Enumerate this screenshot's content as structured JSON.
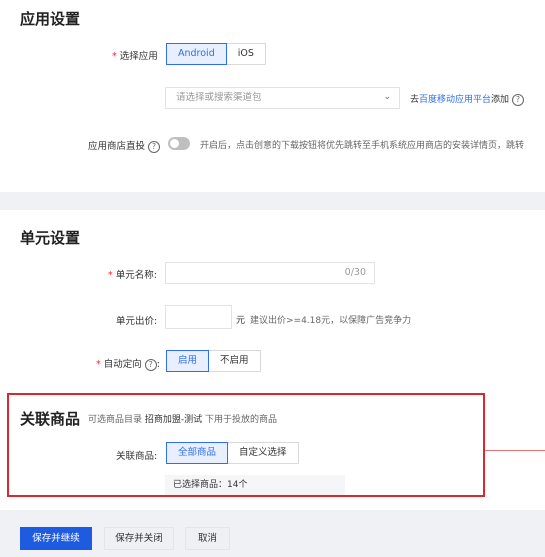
{
  "app_settings": {
    "title": "应用设置",
    "select_app_label": "选择应用",
    "required_mark": "*",
    "app_options": [
      "Android",
      "iOS"
    ],
    "selected_app": "Android",
    "channel_placeholder": "请选择或搜索渠道包",
    "add_prefix": "去",
    "add_link": "百度移动应用平台",
    "add_suffix": "添加",
    "store_direct_label": "应用商店直投",
    "store_direct_hint": "开启后，点击创意的下载按钮将优先跳转至手机系统应用商店的安装详情页，跳转",
    "store_direct_enabled": false
  },
  "unit_settings": {
    "title": "单元设置",
    "name_label": "单元名称:",
    "name_counter": "0/30",
    "bid_label": "单元出价:",
    "bid_unit": "元",
    "bid_hint": "建议出价>=4.18元，以保障广告竞争力",
    "targeting_label": "自动定向",
    "targeting_colon": ":",
    "targeting_options": [
      "启用",
      "不启用"
    ],
    "targeting_selected": "启用"
  },
  "linked_products": {
    "title": "关联商品",
    "desc_prefix": "可选商品目录",
    "desc_catalog": "招商加盟-测试",
    "desc_suffix": "下用于投放的商品",
    "label": "关联商品:",
    "options": [
      "全部商品",
      "自定义选择"
    ],
    "selected": "全部商品",
    "selected_count_text": "已选择商品：14个"
  },
  "footer": {
    "save_continue": "保存并继续",
    "save_close": "保存并关闭",
    "cancel": "取消"
  },
  "colors": {
    "primary": "#1d5ce0",
    "highlight_border": "#d9282f"
  },
  "icons": [
    "chevron-down-icon",
    "question-circle-icon"
  ]
}
